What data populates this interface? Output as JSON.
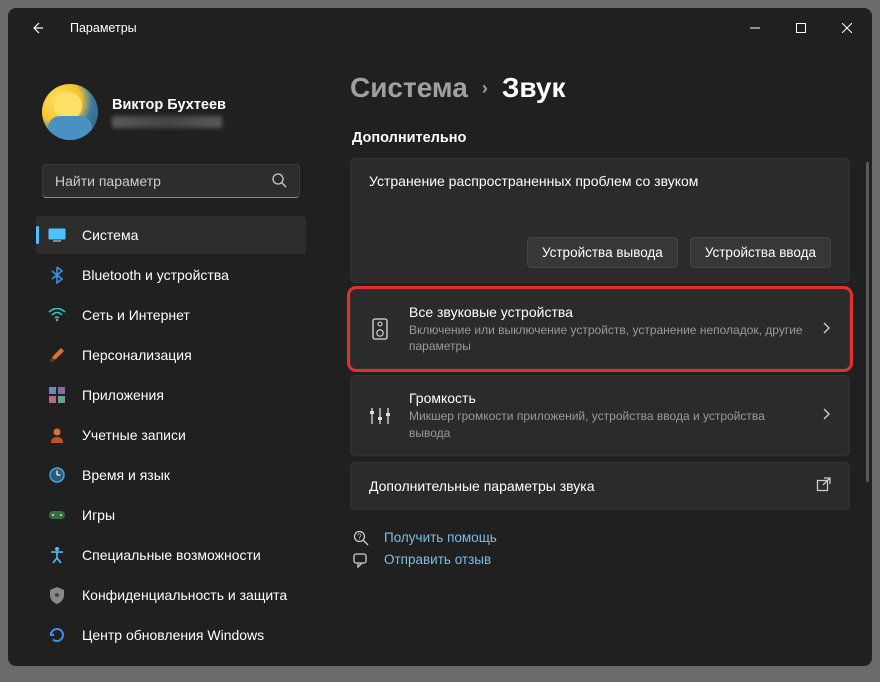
{
  "titlebar": {
    "title": "Параметры"
  },
  "profile": {
    "name": "Виктор Бухтеев"
  },
  "search": {
    "placeholder": "Найти параметр"
  },
  "nav": {
    "items": [
      {
        "label": "Система",
        "iconColor": "#4cc2ff",
        "active": true,
        "icon": "system"
      },
      {
        "label": "Bluetooth и устройства",
        "iconColor": "#3d94e8",
        "icon": "bluetooth"
      },
      {
        "label": "Сеть и Интернет",
        "iconColor": "#36c9c9",
        "icon": "wifi"
      },
      {
        "label": "Персонализация",
        "iconColor": "#e07030",
        "icon": "brush"
      },
      {
        "label": "Приложения",
        "iconColor": "#6b8ab0",
        "icon": "apps"
      },
      {
        "label": "Учетные записи",
        "iconColor": "#e07030",
        "icon": "account"
      },
      {
        "label": "Время и язык",
        "iconColor": "#4fa0e0",
        "icon": "time"
      },
      {
        "label": "Игры",
        "iconColor": "#5aa060",
        "icon": "games"
      },
      {
        "label": "Специальные возможности",
        "iconColor": "#4cc2ff",
        "icon": "accessibility"
      },
      {
        "label": "Конфиденциальность и защита",
        "iconColor": "#b0b0b0",
        "icon": "privacy"
      },
      {
        "label": "Центр обновления Windows",
        "iconColor": "#3d94e8",
        "icon": "update"
      }
    ]
  },
  "breadcrumb": {
    "parent": "Система",
    "current": "Звук"
  },
  "section": {
    "additional": "Дополнительно"
  },
  "troubleshoot": {
    "title": "Устранение распространенных проблем со звуком",
    "outputBtn": "Устройства вывода",
    "inputBtn": "Устройства ввода"
  },
  "rows": {
    "allDevices": {
      "title": "Все звуковые устройства",
      "sub": "Включение или выключение устройств, устранение неполадок, другие параметры"
    },
    "volume": {
      "title": "Громкость",
      "sub": "Микшер громкости приложений, устройства ввода и устройства вывода"
    },
    "more": {
      "title": "Дополнительные параметры звука"
    }
  },
  "footer": {
    "help": "Получить помощь",
    "feedback": "Отправить отзыв"
  }
}
